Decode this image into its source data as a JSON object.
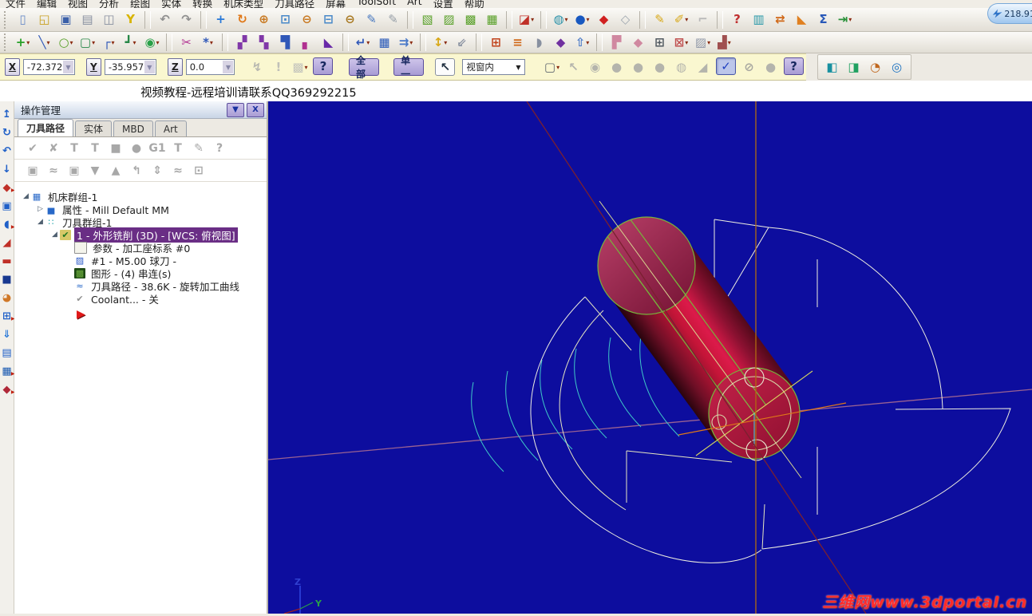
{
  "app": {
    "speed_overlay_value": "218.91"
  },
  "menu_bar": {
    "items": [
      "文件",
      "编辑",
      "视图",
      "分析",
      "绘图",
      "实体",
      "转换",
      "机床类型",
      "刀具路径",
      "屏幕",
      "ToolSoft",
      "Art",
      "设置",
      "帮助"
    ]
  },
  "banner": {
    "text": "视频教程-远程培训请联系QQ369292215"
  },
  "toolbar_row1": {
    "items": [
      {
        "n": "new-file",
        "g": "▯",
        "c": "#6A8CC8"
      },
      {
        "n": "open-file",
        "g": "◱",
        "c": "#C8A020"
      },
      {
        "n": "save-file",
        "g": "▣",
        "c": "#3A5FA8"
      },
      {
        "n": "print",
        "g": "▤",
        "c": "#8890A0"
      },
      {
        "n": "print-preview",
        "g": "◫",
        "c": "#8890A0"
      },
      {
        "n": "configure",
        "g": "Y",
        "c": "#D8B400"
      },
      {
        "sep": true
      },
      {
        "n": "undo",
        "g": "↶",
        "c": "#909090"
      },
      {
        "n": "redo",
        "g": "↷",
        "c": "#909090"
      },
      {
        "sep": true
      },
      {
        "n": "pan",
        "g": "+",
        "c": "#2878D8"
      },
      {
        "n": "dynamic-rotate",
        "g": "↻",
        "c": "#E07818"
      },
      {
        "n": "zoom-in-window",
        "g": "⊕",
        "c": "#C87820"
      },
      {
        "n": "zoom-window",
        "g": "⊡",
        "c": "#4888C8"
      },
      {
        "n": "zoom-selected",
        "g": "⊖",
        "c": "#C87820"
      },
      {
        "n": "zoom-out-80",
        "g": "⊟",
        "c": "#4888C8"
      },
      {
        "n": "zoom-out",
        "g": "⊖",
        "c": "#A87820"
      },
      {
        "n": "blank-screen-pen",
        "g": "✎",
        "c": "#4878C0"
      },
      {
        "n": "repaint-screen",
        "g": "✎",
        "c": "#98A0A8"
      },
      {
        "sep": true
      },
      {
        "n": "gview-top",
        "g": "▧",
        "c": "#58A028"
      },
      {
        "n": "gview-front",
        "g": "▨",
        "c": "#58A028"
      },
      {
        "n": "gview-side",
        "g": "▩",
        "c": "#58A028"
      },
      {
        "n": "gview-isometric",
        "g": "▦",
        "c": "#58A028"
      },
      {
        "sep": true
      },
      {
        "n": "gview-named",
        "g": "◪",
        "c": "#C03028",
        "dd": true
      },
      {
        "sep": true
      },
      {
        "n": "wireframe-display",
        "g": "◍",
        "c": "#2890A8",
        "dd": true
      },
      {
        "n": "shaded-display",
        "g": "●",
        "c": "#1858C0",
        "dd": true
      },
      {
        "n": "translucent-display",
        "g": "◆",
        "c": "#D02020"
      },
      {
        "n": "wireframe-box-display",
        "g": "◇",
        "c": "#A0A8B0"
      },
      {
        "sep": true
      },
      {
        "n": "attributes-pencil",
        "g": "✎",
        "c": "#D8A818"
      },
      {
        "n": "attributes-multi",
        "g": "✐",
        "c": "#D8A818",
        "dd": true
      },
      {
        "n": "attributes-disabled",
        "g": "⌐",
        "c": "#B8B8B8"
      },
      {
        "sep": true
      },
      {
        "n": "analyze-position",
        "g": "?",
        "c": "#C03030"
      },
      {
        "n": "analyze-distance",
        "g": "▥",
        "c": "#2898A8"
      },
      {
        "n": "analyze-dynamic",
        "g": "⇄",
        "c": "#D06818"
      },
      {
        "n": "analyze-angle",
        "g": "◣",
        "c": "#E08020"
      },
      {
        "n": "analyze-sum",
        "g": "Σ",
        "c": "#2858B8"
      },
      {
        "n": "exit-function",
        "g": "⇥",
        "c": "#289038",
        "dd": true
      }
    ]
  },
  "toolbar_row2": {
    "items": [
      {
        "n": "create-point-plus",
        "g": "+",
        "c": "#28A028",
        "dd": true
      },
      {
        "n": "create-line",
        "g": "╲",
        "c": "#3058B8",
        "dd": true
      },
      {
        "n": "create-circle",
        "g": "○",
        "c": "#58A028",
        "dd": true
      },
      {
        "n": "create-rectangle",
        "g": "▢",
        "c": "#288848",
        "dd": true
      },
      {
        "n": "create-fillet",
        "g": "┌",
        "c": "#3058B8",
        "dd": true
      },
      {
        "n": "create-polyline",
        "g": "┛",
        "c": "#288848",
        "dd": true
      },
      {
        "n": "create-primitives",
        "g": "◉",
        "c": "#28A048",
        "dd": true
      },
      {
        "sep": true
      },
      {
        "n": "trim-break",
        "g": "✂",
        "c": "#B03090"
      },
      {
        "n": "create-points",
        "g": "*",
        "c": "#3058B8",
        "dd": true
      },
      {
        "sep": true
      },
      {
        "n": "xform-translate",
        "g": "▞",
        "c": "#8038A8"
      },
      {
        "n": "xform-mirror",
        "g": "▚",
        "c": "#8038A8"
      },
      {
        "n": "xform-rotate",
        "g": "▜",
        "c": "#3058B8"
      },
      {
        "n": "xform-scale",
        "g": "▖",
        "c": "#B03090"
      },
      {
        "n": "xform-dynamic",
        "g": "◣",
        "c": "#6828A8"
      },
      {
        "sep": true
      },
      {
        "n": "xform-offset",
        "g": "↵",
        "c": "#3058B8",
        "dd": true
      },
      {
        "n": "xform-array",
        "g": "▦",
        "c": "#2858B8"
      },
      {
        "n": "xform-project",
        "g": "⇉",
        "c": "#4878C8",
        "dd": true
      },
      {
        "sep": true
      },
      {
        "n": "shade-toggle",
        "g": "↕",
        "c": "#D8A818",
        "dd": true
      },
      {
        "n": "shade-options",
        "g": "⇙",
        "c": "#8890A0"
      },
      {
        "sep": true
      },
      {
        "n": "plane-grid",
        "g": "⊞",
        "c": "#C04018"
      },
      {
        "n": "level-manager",
        "g": "≡",
        "c": "#D06818"
      },
      {
        "n": "blend-half",
        "g": "◗",
        "c": "#8890A0"
      },
      {
        "n": "wedge-tool",
        "g": "◆",
        "c": "#7030A0"
      },
      {
        "n": "lift-box",
        "g": "⇧",
        "c": "#4878C8",
        "dd": true
      },
      {
        "sep": true
      },
      {
        "n": "solids-history",
        "g": "▛",
        "c": "#D088A0"
      },
      {
        "n": "solids-bloom",
        "g": "◆",
        "c": "#D088A0"
      },
      {
        "n": "wire-cube",
        "g": "⊞",
        "c": "#505860"
      },
      {
        "n": "remove-faces",
        "g": "⊠",
        "c": "#C05050",
        "dd": true
      },
      {
        "n": "striped-solid",
        "g": "▨",
        "c": "#9098A8",
        "dd": true
      },
      {
        "n": "machine-tool",
        "g": "▟",
        "c": "#A05050",
        "dd": true
      }
    ]
  },
  "coord_bar": {
    "x_label": "X",
    "x_value": "-72.37282",
    "y_label": "Y",
    "y_value": "-35.95706",
    "z_label": "Z",
    "z_value": "0.0",
    "select_all_label": "全部",
    "select_single_label": "单一",
    "window_mode_value": "视窗内",
    "icons_a": [
      {
        "n": "fastpoint",
        "g": "↯",
        "c": "#B8B8B0"
      },
      {
        "n": "cursor-override",
        "g": "!",
        "c": "#C0C0B8"
      },
      {
        "n": "autocursor-config",
        "g": "▩",
        "c": "#C4C4BC",
        "dd": true
      },
      {
        "n": "autocursor-help",
        "g": "?",
        "c": "#182860",
        "k": "p"
      }
    ],
    "icons_b": [
      {
        "n": "selection-cursor",
        "g": "↖",
        "c": "#203040",
        "k": "w"
      }
    ],
    "icons_c": [
      {
        "n": "window-shape",
        "g": "▢",
        "c": "#606870",
        "dd": true
      },
      {
        "n": "select-last",
        "g": "↖",
        "c": "#B4B4AC"
      },
      {
        "n": "select-result",
        "g": "◉",
        "c": "#B4B4AC"
      },
      {
        "n": "select-group-1",
        "g": "●",
        "c": "#B4B4AC"
      },
      {
        "n": "select-group-2",
        "g": "●",
        "c": "#B4B4AC"
      },
      {
        "n": "select-group-3",
        "g": "●",
        "c": "#B4B4AC"
      },
      {
        "n": "select-mask",
        "g": "◍",
        "c": "#B4B4AC"
      },
      {
        "n": "select-corner",
        "g": "◢",
        "c": "#B4B4AC"
      },
      {
        "n": "select-validate",
        "g": "✓",
        "c": "#2040C0",
        "k": "pr"
      },
      {
        "n": "select-void",
        "g": "⊘",
        "c": "#A8A8A0"
      },
      {
        "n": "select-sphere",
        "g": "●",
        "c": "#B4B4AC"
      },
      {
        "n": "selection-help",
        "g": "?",
        "c": "#182860",
        "k": "p"
      }
    ]
  },
  "verify_toolbar": {
    "items": [
      {
        "n": "toolpath-stock-setup",
        "g": "◧",
        "c": "#1890A0"
      },
      {
        "n": "toolpath-stock-display",
        "g": "◨",
        "c": "#20A060"
      },
      {
        "n": "backplot-rewind",
        "g": "◔",
        "c": "#C06820"
      },
      {
        "n": "verify-target",
        "g": "◎",
        "c": "#1870C0"
      }
    ]
  },
  "left_toolbar": {
    "items": [
      {
        "n": "view-shift-up",
        "g": "↥",
        "c": "#2060C8"
      },
      {
        "n": "view-rotate",
        "g": "↻",
        "c": "#2060C8"
      },
      {
        "n": "view-undo",
        "g": "↶",
        "c": "#2060C8"
      },
      {
        "n": "view-shift-down",
        "g": "↓",
        "c": "#2060C8"
      },
      {
        "n": "delete-entities",
        "g": "◆",
        "c": "#C03028",
        "dd": true
      },
      {
        "n": "viewport-frame",
        "g": "▣",
        "c": "#2060C8"
      },
      {
        "n": "shade-hemisphere",
        "g": "◖",
        "c": "#2060C8",
        "dd": true
      },
      {
        "n": "plane-wedge",
        "g": "◢",
        "c": "#C03028"
      },
      {
        "n": "plane-flat",
        "g": "▬",
        "c": "#C03028"
      },
      {
        "n": "cube-solid",
        "g": "■",
        "c": "#183890"
      },
      {
        "n": "fill-tank",
        "g": "◕",
        "c": "#D07828"
      },
      {
        "n": "grid-globe",
        "g": "⊞",
        "c": "#2060C8",
        "dd": true
      },
      {
        "n": "arrow-down-blue",
        "g": "⇓",
        "c": "#2878D8"
      },
      {
        "n": "panel-device",
        "g": "▤",
        "c": "#2060C8"
      },
      {
        "n": "grid-window",
        "g": "▦",
        "c": "#1858B0",
        "dd": true
      },
      {
        "n": "solids-red",
        "g": "◆",
        "c": "#B02838",
        "dd": true
      }
    ]
  },
  "ops_panel": {
    "title": "操作管理",
    "collapse_glyph": "▼",
    "close_glyph": "X",
    "tabs": [
      {
        "label": "刀具路径",
        "active": true
      },
      {
        "label": "实体",
        "active": false
      },
      {
        "label": "MBD",
        "active": false
      },
      {
        "label": "Art",
        "active": false
      }
    ],
    "toolbar1": [
      {
        "n": "ops-select-all",
        "g": "✔",
        "c": "#A8A8A8"
      },
      {
        "n": "ops-select-none",
        "g": "✘",
        "c": "#A8A8A8"
      },
      {
        "n": "ops-regen-selected",
        "g": "T",
        "c": "#A8A8A8"
      },
      {
        "n": "ops-regen-all",
        "g": "T",
        "c": "#A8A8A8"
      },
      {
        "n": "ops-backplot-stop",
        "g": "■",
        "c": "#A8A8A8"
      },
      {
        "n": "ops-verify",
        "g": "●",
        "c": "#A8A8A8"
      },
      {
        "n": "ops-post-g1",
        "g": "G1",
        "c": "#A8A8A8"
      },
      {
        "n": "ops-post-out",
        "g": "T",
        "c": "#A8A8A8"
      },
      {
        "n": "ops-edit",
        "g": "✎",
        "c": "#A8A8A8"
      },
      {
        "n": "ops-help",
        "g": "?",
        "c": "#A8A8A8"
      }
    ],
    "toolbar2": [
      {
        "n": "ops-lock",
        "g": "▣",
        "c": "#A8A8A8"
      },
      {
        "n": "ops-toggle-display",
        "g": "≈",
        "c": "#A8A8A8"
      },
      {
        "n": "ops-lock-ghost",
        "g": "▣",
        "c": "#A8A8A8"
      },
      {
        "n": "ops-move-down",
        "g": "▼",
        "c": "#A8A8A8"
      },
      {
        "n": "ops-move-up",
        "g": "▲",
        "c": "#A8A8A8"
      },
      {
        "n": "ops-insert",
        "g": "↰",
        "c": "#A8A8A8"
      },
      {
        "n": "ops-scroll",
        "g": "⇕",
        "c": "#A8A8A8"
      },
      {
        "n": "ops-toggle-all",
        "g": "≈",
        "c": "#A8A8A8"
      },
      {
        "n": "ops-copy",
        "g": "⊡",
        "c": "#A8A8A8"
      }
    ],
    "tree": [
      {
        "name": "tree-machine-group",
        "level": 0,
        "exp": "open",
        "label": "机床群组-1",
        "icon": {
          "g": "▦",
          "c": "#2868C8"
        }
      },
      {
        "name": "tree-properties",
        "level": 1,
        "exp": "closed",
        "label": "属性 - Mill Default MM",
        "icon": {
          "g": "▅",
          "c": "#2868C8"
        }
      },
      {
        "name": "tree-tool-group",
        "level": 1,
        "exp": "open",
        "label": "刀具群组-1",
        "icon": {
          "g": "∷",
          "c": "#18A0A8"
        }
      },
      {
        "name": "tree-operation-1",
        "level": 2,
        "exp": "open",
        "label": "1 - 外形铣削 (3D) - [WCS: 俯视图]",
        "selected": true,
        "icon": {
          "g": "✔",
          "c": "#207820",
          "bg": "#D8C868"
        }
      },
      {
        "name": "tree-parameters",
        "level": 3,
        "exp": "none",
        "label": "参数 - 加工座标系 #0",
        "icon": {
          "g": "",
          "c": "#808080",
          "bg": "#F4F4EC",
          "bd": "#909090"
        }
      },
      {
        "name": "tree-tool",
        "level": 3,
        "exp": "none",
        "label": "#1 - M5.00 球刀 -",
        "icon": {
          "g": "▨",
          "c": "#2858C8"
        }
      },
      {
        "name": "tree-geometry",
        "level": 3,
        "exp": "none",
        "label": "图形 - (4) 串连(s)",
        "icon": {
          "g": "▩",
          "c": "#70B040",
          "bg": "#1E4A14"
        }
      },
      {
        "name": "tree-toolpath",
        "level": 3,
        "exp": "none",
        "label": "刀具路径 - 38.6K - 旋转加工曲线",
        "icon": {
          "g": "≈",
          "c": "#2868C8"
        }
      },
      {
        "name": "tree-coolant",
        "level": 3,
        "exp": "none",
        "label": "Coolant... - 关",
        "icon": {
          "g": "✔",
          "c": "#909090"
        }
      }
    ]
  },
  "viewport": {
    "background": "#0D0D9E",
    "axis_z_label": "Z",
    "axis_y_label": "Y",
    "watermark": "三维网www.3dportal.cn",
    "colors": {
      "cylinder_body": "#C51538",
      "wireframe_green": "#76B53C",
      "toolpath_khaki": "#E6E6C0",
      "toolpath_cyan": "#3FC8C8",
      "crosshair_vertical": "#B06A10",
      "diagonal_maroon": "#7A2030",
      "horizontal_mauve": "#9A6292"
    }
  }
}
